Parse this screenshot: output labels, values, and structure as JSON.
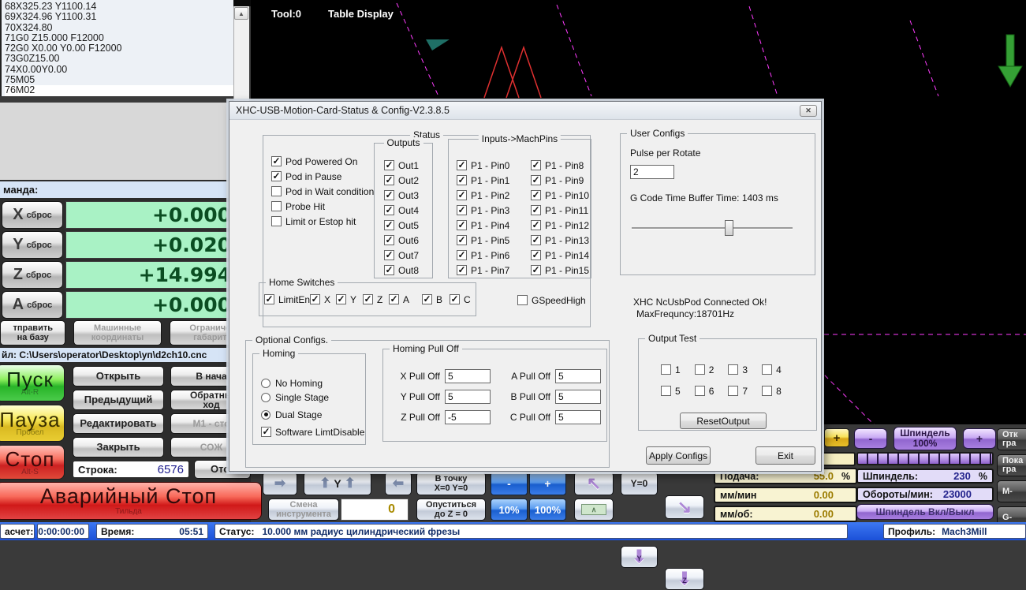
{
  "icons": {
    "scroll_up": "▲",
    "close": "✕",
    "arrow_right": "➡",
    "arrow_left": "⬅",
    "arrow_up": "⬆",
    "arrow_down": "⬇",
    "diag_up_left": "↖",
    "diag_down_right": "↘",
    "caret": "∧"
  },
  "gcode": {
    "lines": [
      "68X325.23 Y1100.14",
      "69X324.96 Y1100.31",
      "70X324.80",
      "71G0  Z15.000 F12000",
      "72G0 X0.00 Y0.00  F12000",
      "73G0Z15.00",
      "74X0.00Y0.00",
      "75M05",
      "76M02"
    ]
  },
  "toolpath": {
    "tool": "Tool:0",
    "mode": "Table Display"
  },
  "dialog": {
    "title": "XHC-USB-Motion-Card-Status & Config-V2.3.8.5",
    "status": {
      "label": "Status",
      "items": [
        {
          "label": "Pod Powered On",
          "on": true
        },
        {
          "label": "Pod in Pause",
          "on": true
        },
        {
          "label": "Pod in Wait condition",
          "on": false
        },
        {
          "label": "Probe Hit",
          "on": false
        },
        {
          "label": "Limit or Estop hit",
          "on": false
        }
      ]
    },
    "outputs": {
      "label": "Outputs",
      "items": [
        {
          "label": "Out1",
          "on": true
        },
        {
          "label": "Out2",
          "on": true
        },
        {
          "label": "Out3",
          "on": true
        },
        {
          "label": "Out4",
          "on": true
        },
        {
          "label": "Out5",
          "on": true
        },
        {
          "label": "Out6",
          "on": true
        },
        {
          "label": "Out7",
          "on": true
        },
        {
          "label": "Out8",
          "on": true
        }
      ]
    },
    "inputs": {
      "label": "Inputs->MachPins",
      "left": [
        {
          "label": "P1 - Pin0",
          "on": true
        },
        {
          "label": "P1 - Pin1",
          "on": true
        },
        {
          "label": "P1 - Pin2",
          "on": true
        },
        {
          "label": "P1 - Pin3",
          "on": true
        },
        {
          "label": "P1 - Pin4",
          "on": true
        },
        {
          "label": "P1 - Pin5",
          "on": true
        },
        {
          "label": "P1 - Pin6",
          "on": true
        },
        {
          "label": "P1 - Pin7",
          "on": true
        }
      ],
      "right": [
        {
          "label": "P1 - Pin8",
          "on": true
        },
        {
          "label": "P1 - Pin9",
          "on": true
        },
        {
          "label": "P1 - Pin10",
          "on": true
        },
        {
          "label": "P1 - Pin11",
          "on": true
        },
        {
          "label": "P1 - Pin12",
          "on": true
        },
        {
          "label": "P1 - Pin13",
          "on": true
        },
        {
          "label": "P1 - Pin14",
          "on": true
        },
        {
          "label": "P1 - Pin15",
          "on": true
        }
      ]
    },
    "home": {
      "label": "Home Switches",
      "items": [
        {
          "label": "LimitEn",
          "on": true
        },
        {
          "label": "X",
          "on": true
        },
        {
          "label": "Y",
          "on": true
        },
        {
          "label": "Z",
          "on": true
        },
        {
          "label": "A",
          "on": true
        },
        {
          "label": "B",
          "on": true
        },
        {
          "label": "C",
          "on": true
        }
      ]
    },
    "gspeed": {
      "label": "GSpeedHigh",
      "on": false
    },
    "user": {
      "label": "User Configs",
      "pulse_label": "Pulse per Rotate",
      "pulse_value": "2",
      "buffer_text": "G Code Time Buffer Time: 1403 ms"
    },
    "conn": {
      "line1": "XHC NcUsbPod Connected Ok!",
      "line2": "MaxFrequncy:18701Hz"
    },
    "optional": {
      "label": "Optional Configs.",
      "homing": {
        "label": "Homing",
        "options": [
          {
            "label": "No Homing",
            "on": false
          },
          {
            "label": "Single Stage",
            "on": false
          },
          {
            "label": "Dual Stage",
            "on": true
          }
        ]
      },
      "limit": {
        "label": "Software LimtDisable",
        "on": true
      },
      "pulloff": {
        "label": "Homing Pull Off",
        "left": [
          {
            "label": "X Pull Off",
            "value": "5"
          },
          {
            "label": "Y Pull Off",
            "value": "5"
          },
          {
            "label": "Z Pull Off",
            "value": "-5"
          }
        ],
        "right": [
          {
            "label": "A Pull Off",
            "value": "5"
          },
          {
            "label": "B Pull Off",
            "value": "5"
          },
          {
            "label": "C Pull Off",
            "value": "5"
          }
        ]
      }
    },
    "output_test": {
      "label": "Output Test",
      "row1": [
        {
          "label": "1",
          "on": false
        },
        {
          "label": "2",
          "on": false
        },
        {
          "label": "3",
          "on": false
        },
        {
          "label": "4",
          "on": false
        }
      ],
      "row2": [
        {
          "label": "5",
          "on": false
        },
        {
          "label": "6",
          "on": false
        },
        {
          "label": "7",
          "on": false
        },
        {
          "label": "8",
          "on": false
        }
      ],
      "reset": "ResetOutput"
    },
    "apply": "Apply Configs",
    "exit": "Exit"
  },
  "left": {
    "command_label": "манда:",
    "dro": [
      {
        "axis": "X",
        "reset": "сброс",
        "value": "+0.000"
      },
      {
        "axis": "Y",
        "reset": "сброс",
        "value": "+0.020"
      },
      {
        "axis": "Z",
        "reset": "сброс",
        "value": "+14.994"
      },
      {
        "axis": "A",
        "reset": "сброс",
        "value": "+0.000"
      }
    ],
    "top_buttons": [
      {
        "label": "тправить\nна базу",
        "dis": false
      },
      {
        "label": "Машинные\nкоординаты",
        "dis": true
      },
      {
        "label": "Ограниче\nгабарит",
        "dis": true
      }
    ],
    "file_line": "йл:   C:\\Users\\operator\\Desktop\\уп\\d2ch10.cnc",
    "run": [
      {
        "label": "Пуск",
        "sub": "Alt-R",
        "kind": "start"
      },
      {
        "label": "Пауза",
        "sub": "Пробел",
        "kind": "pause"
      },
      {
        "label": "Стоп",
        "sub": "Alt-S",
        "kind": "stop"
      }
    ],
    "file_buttons": [
      {
        "label": "Открыть",
        "dis": false
      },
      {
        "label": "Предыдущий",
        "dis": false
      },
      {
        "label": "Редактировать",
        "dis": false
      },
      {
        "label": "Закрыть",
        "dis": false
      }
    ],
    "side_buttons": [
      {
        "label": "В нача",
        "dis": false
      },
      {
        "label": "Обратны\nход",
        "dis": false
      },
      {
        "label": "М1 - сто",
        "dis": true
      },
      {
        "label": "СОЖ",
        "dis": true
      }
    ],
    "line_label": "Строка:",
    "line_value": "6576",
    "retract_label": "Отск",
    "estop": {
      "label": "Аварийный Стоп",
      "sub": "Тильда"
    }
  },
  "jog": {
    "y_label": "Y",
    "to_xy": "В точку\nX=0 Y=0",
    "minus": "-",
    "plus": "+",
    "tool_change": "Смена\nинструмента",
    "tool_value": "0",
    "to_z": "Опуститься\nдо Z = 0",
    "p10": "10%",
    "p100": "100%",
    "y0": "Y=0",
    "axis_y": "Y",
    "axis_z": "Z"
  },
  "feed": {
    "plus": "+",
    "rows": [
      {
        "label": "Подача:",
        "value": "55.0",
        "unit": "%"
      },
      {
        "label": "мм/мин",
        "value": "0.00",
        "unit": ""
      },
      {
        "label": "мм/об:",
        "value": "0.00",
        "unit": ""
      }
    ]
  },
  "spindle": {
    "minus": "-",
    "plus": "+",
    "btn100": "Шпиндель\n100%",
    "rows": [
      {
        "label": "Шпиндель:",
        "value": "230",
        "unit": "%"
      },
      {
        "label": "Обороты/мин:",
        "value": "23000",
        "unit": ""
      }
    ],
    "toggle": "Шпиндель Вкл/Выкл"
  },
  "edge_buttons": [
    "Отк\nгра",
    "Пока\nгра",
    "М-",
    "G-"
  ],
  "statusbar": {
    "calc_label": "асчет:",
    "calc_value": "0:00:00:00",
    "time_label": "Время:",
    "time_value": "05:51",
    "status_label": "Статус:",
    "status_value": "10.000 мм радиус цилиндрический фрезы",
    "profile_label": "Профиль:",
    "profile_value": "Mach3Mill"
  }
}
